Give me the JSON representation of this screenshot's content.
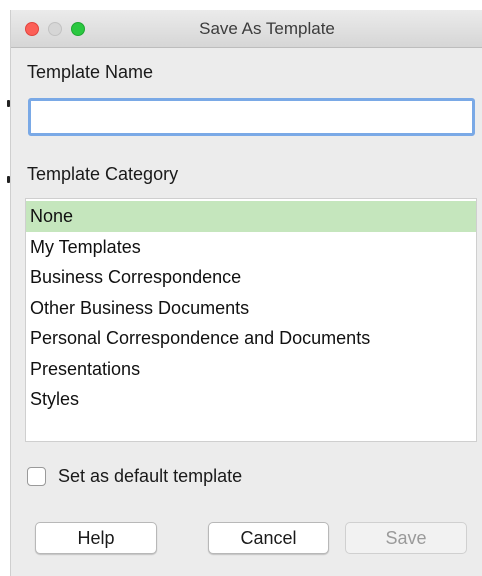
{
  "window": {
    "title": "Save As Template"
  },
  "template_name": {
    "label": "Template Name",
    "value": "",
    "placeholder": ""
  },
  "template_category": {
    "label": "Template Category",
    "items": [
      {
        "label": "None",
        "selected": true
      },
      {
        "label": "My Templates",
        "selected": false
      },
      {
        "label": "Business Correspondence",
        "selected": false
      },
      {
        "label": "Other Business Documents",
        "selected": false
      },
      {
        "label": "Personal Correspondence and Documents",
        "selected": false
      },
      {
        "label": "Presentations",
        "selected": false
      },
      {
        "label": "Styles",
        "selected": false
      }
    ]
  },
  "default_template": {
    "label": "Set as default template",
    "checked": false
  },
  "buttons": {
    "help": "Help",
    "cancel": "Cancel",
    "save": "Save"
  },
  "colors": {
    "selection": "#c5e6bd",
    "focus_ring": "#7aa9e6",
    "close": "#fc5f57",
    "maximize": "#2ac840"
  }
}
